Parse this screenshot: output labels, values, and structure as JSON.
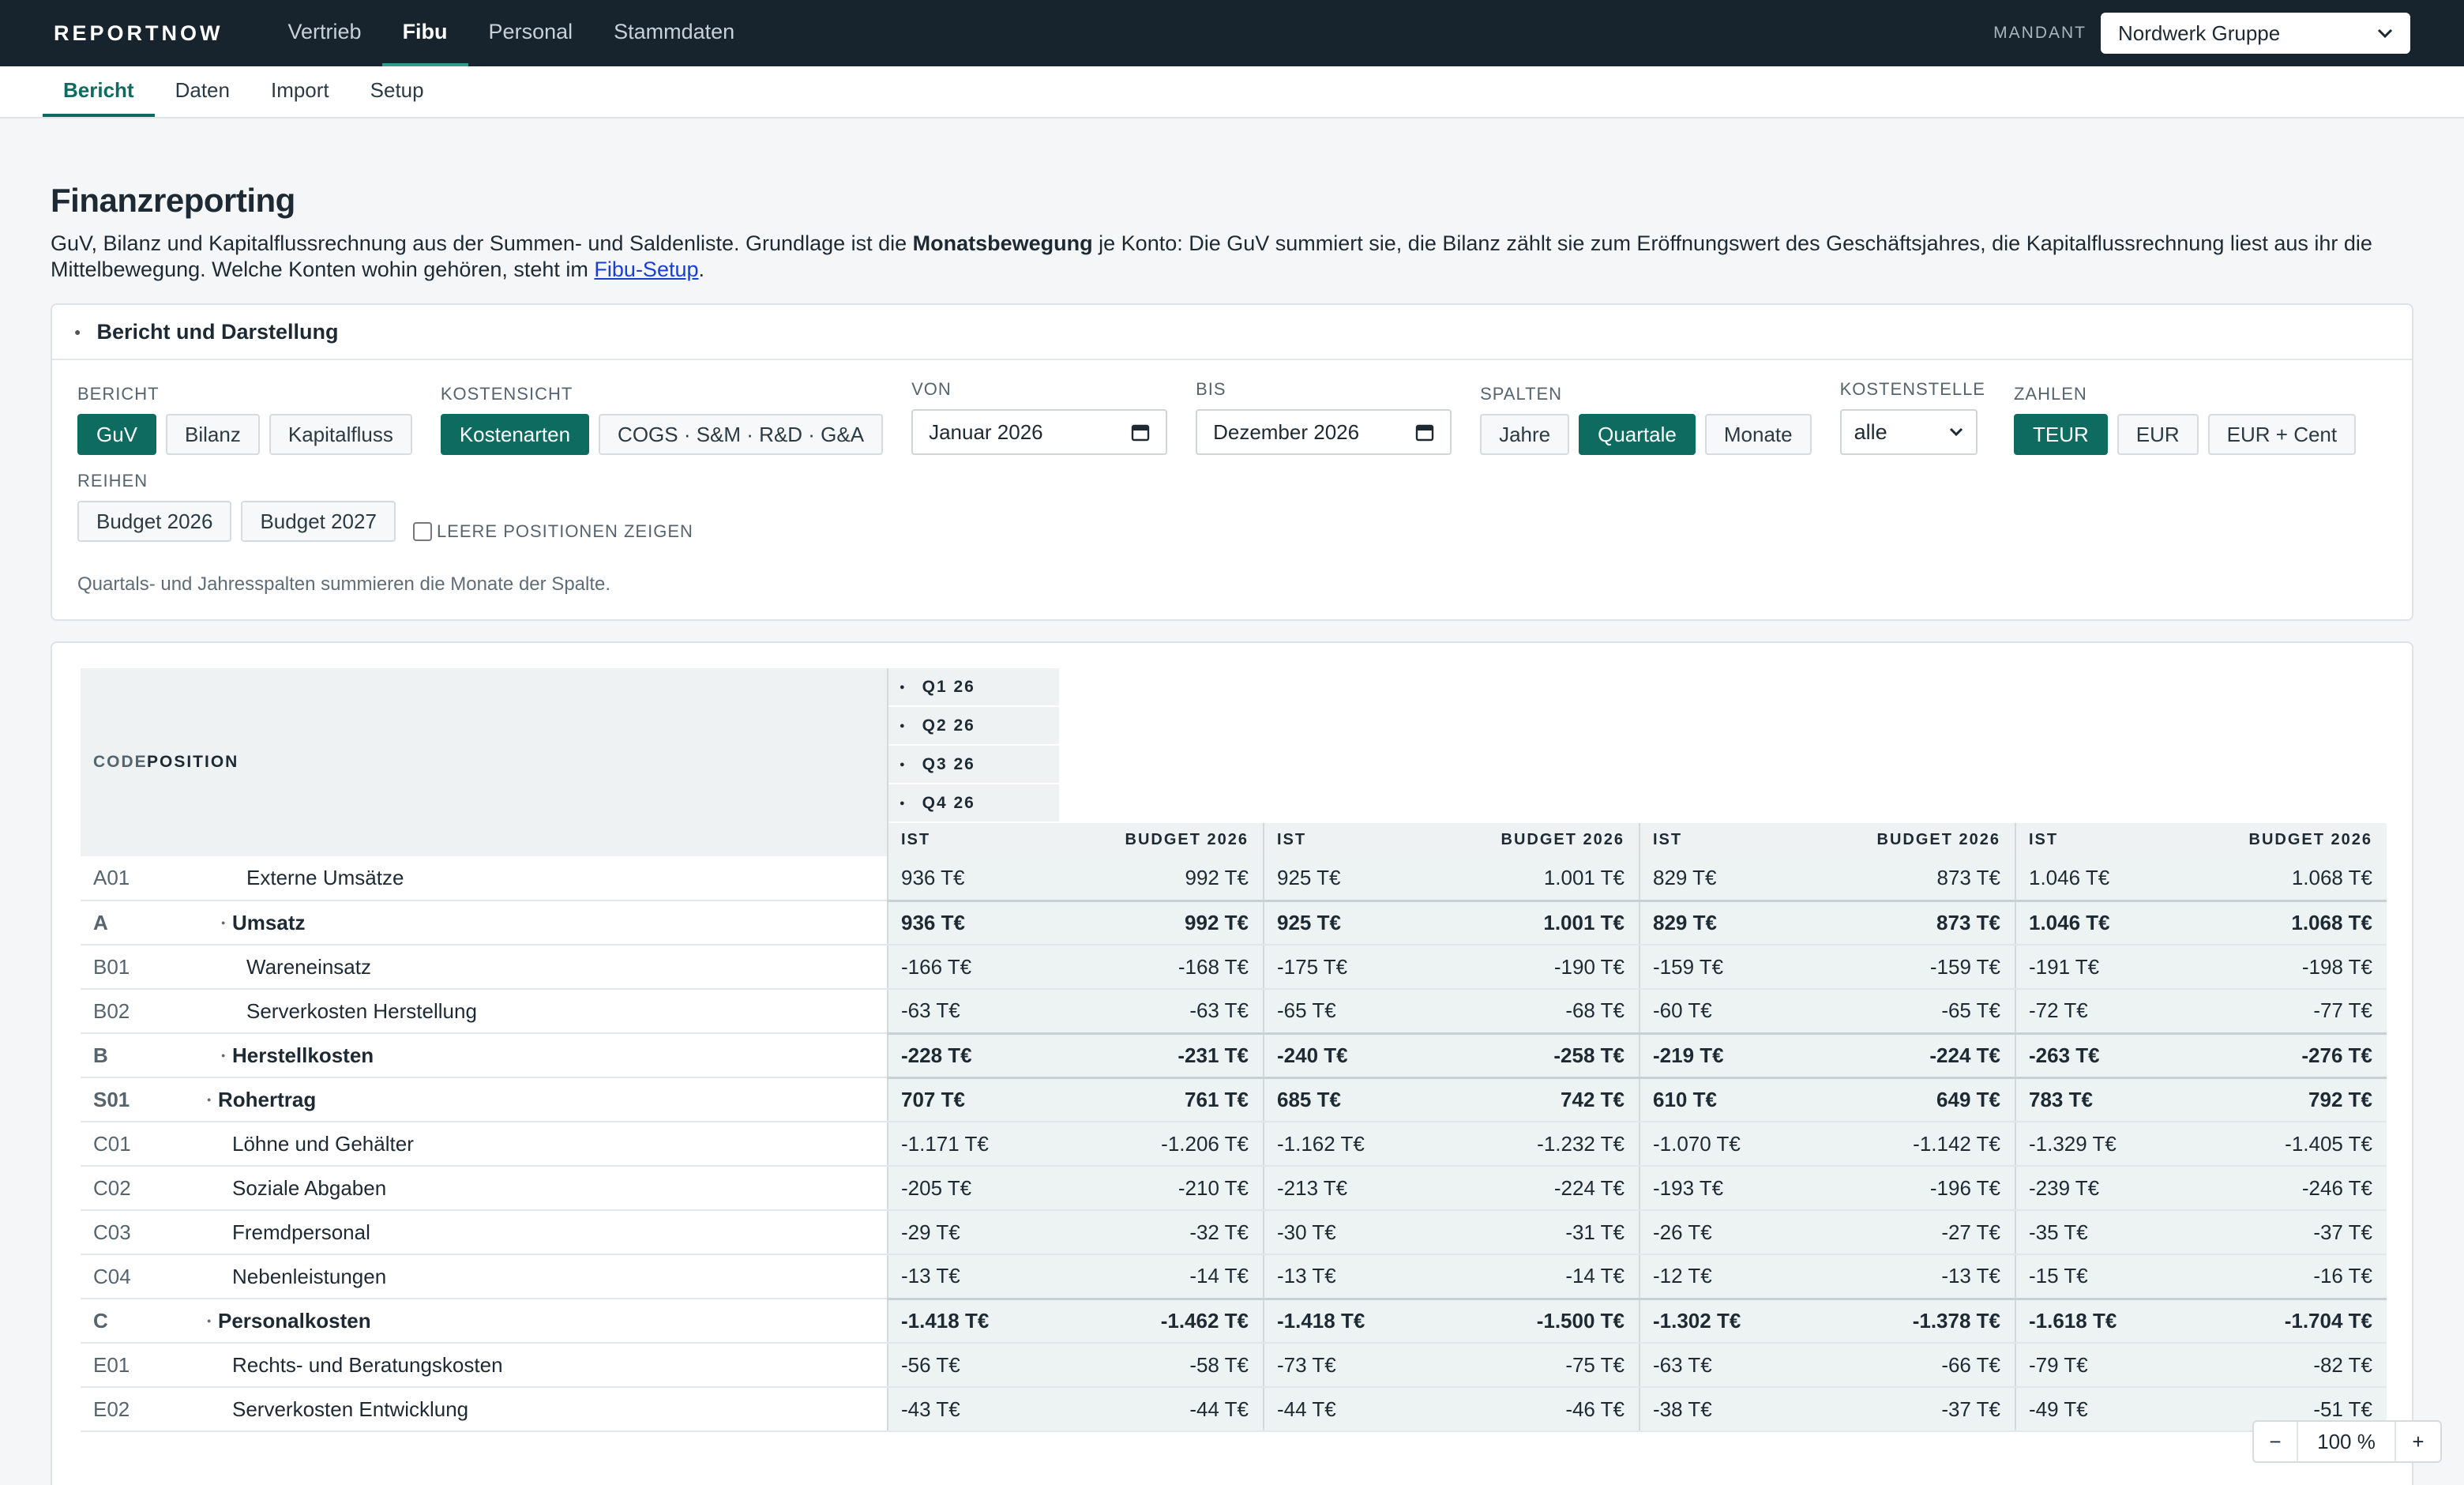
{
  "brand": "REPORTNOW",
  "topnav": [
    "Vertrieb",
    "Fibu",
    "Personal",
    "Stammdaten"
  ],
  "mandant": {
    "label": "MANDANT",
    "value": "Nordwerk Gruppe"
  },
  "subnav": [
    "Bericht",
    "Daten",
    "Import",
    "Setup"
  ],
  "page": {
    "title": "Finanzreporting",
    "desc_1": "GuV, Bilanz und Kapitalflussrechnung aus der Summen- und Saldenliste. Grundlage ist die ",
    "desc_bold": "Monatsbewegung",
    "desc_2": " je Konto: Die GuV summiert sie, die Bilanz zählt sie zum Eröffnungswert des Geschäftsjahres, die Kapitalflussrechnung liest aus ihr die Mittelbewegung. Welche Konten wohin gehören, steht im ",
    "desc_link": "Fibu-Setup",
    "desc_3": "."
  },
  "panel": {
    "title": "Bericht und Darstellung",
    "bericht": {
      "label": "BERICHT",
      "options": [
        "GuV",
        "Bilanz",
        "Kapitalfluss"
      ]
    },
    "kostensicht": {
      "label": "KOSTENSICHT",
      "options": [
        "Kostenarten",
        "COGS · S&M · R&D · G&A"
      ]
    },
    "von": {
      "label": "VON",
      "value": "Januar  2026"
    },
    "bis": {
      "label": "BIS",
      "value": "Dezember  2026"
    },
    "spalten": {
      "label": "SPALTEN",
      "options": [
        "Jahre",
        "Quartale",
        "Monate"
      ]
    },
    "kostenstelle": {
      "label": "KOSTENSTELLE",
      "value": "alle"
    },
    "zahlen": {
      "label": "ZAHLEN",
      "options": [
        "TEUR",
        "EUR",
        "EUR + Cent"
      ]
    },
    "reihen": {
      "label": "REIHEN",
      "options": [
        "Budget 2026",
        "Budget 2027"
      ]
    },
    "leere": "LEERE POSITIONEN ZEIGEN",
    "hint": "Quartals- und Jahresspalten summieren die Monate der Spalte."
  },
  "table": {
    "col_code": "CODE",
    "col_position": "POSITION",
    "quarters": [
      "Q1 26",
      "Q2 26",
      "Q3 26",
      "Q4 26"
    ],
    "sub_ist": "IST",
    "sub_budget": "BUDGET 2026",
    "rows": [
      {
        "code": "A01",
        "name": "Externe Umsätze",
        "v": [
          "936 T€",
          "992 T€",
          "925 T€",
          "1.001 T€",
          "829 T€",
          "873 T€",
          "1.046 T€",
          "1.068 T€"
        ]
      },
      {
        "code": "A",
        "name": "Umsatz",
        "v": [
          "936 T€",
          "992 T€",
          "925 T€",
          "1.001 T€",
          "829 T€",
          "873 T€",
          "1.046 T€",
          "1.068 T€"
        ]
      },
      {
        "code": "B01",
        "name": "Wareneinsatz",
        "v": [
          "-166 T€",
          "-168 T€",
          "-175 T€",
          "-190 T€",
          "-159 T€",
          "-159 T€",
          "-191 T€",
          "-198 T€"
        ]
      },
      {
        "code": "B02",
        "name": "Serverkosten Herstellung",
        "v": [
          "-63 T€",
          "-63 T€",
          "-65 T€",
          "-68 T€",
          "-60 T€",
          "-65 T€",
          "-72 T€",
          "-77 T€"
        ]
      },
      {
        "code": "B",
        "name": "Herstellkosten",
        "v": [
          "-228 T€",
          "-231 T€",
          "-240 T€",
          "-258 T€",
          "-219 T€",
          "-224 T€",
          "-263 T€",
          "-276 T€"
        ]
      },
      {
        "code": "S01",
        "name": "Rohertrag",
        "v": [
          "707 T€",
          "761 T€",
          "685 T€",
          "742 T€",
          "610 T€",
          "649 T€",
          "783 T€",
          "792 T€"
        ]
      },
      {
        "code": "C01",
        "name": "Löhne und Gehälter",
        "v": [
          "-1.171 T€",
          "-1.206 T€",
          "-1.162 T€",
          "-1.232 T€",
          "-1.070 T€",
          "-1.142 T€",
          "-1.329 T€",
          "-1.405 T€"
        ]
      },
      {
        "code": "C02",
        "name": "Soziale Abgaben",
        "v": [
          "-205 T€",
          "-210 T€",
          "-213 T€",
          "-224 T€",
          "-193 T€",
          "-196 T€",
          "-239 T€",
          "-246 T€"
        ]
      },
      {
        "code": "C03",
        "name": "Fremdpersonal",
        "v": [
          "-29 T€",
          "-32 T€",
          "-30 T€",
          "-31 T€",
          "-26 T€",
          "-27 T€",
          "-35 T€",
          "-37 T€"
        ]
      },
      {
        "code": "C04",
        "name": "Nebenleistungen",
        "v": [
          "-13 T€",
          "-14 T€",
          "-13 T€",
          "-14 T€",
          "-12 T€",
          "-13 T€",
          "-15 T€",
          "-16 T€"
        ]
      },
      {
        "code": "C",
        "name": "Personalkosten",
        "v": [
          "-1.418 T€",
          "-1.462 T€",
          "-1.418 T€",
          "-1.500 T€",
          "-1.302 T€",
          "-1.378 T€",
          "-1.618 T€",
          "-1.704 T€"
        ]
      },
      {
        "code": "E01",
        "name": "Rechts- und Beratungskosten",
        "v": [
          "-56 T€",
          "-58 T€",
          "-73 T€",
          "-75 T€",
          "-63 T€",
          "-66 T€",
          "-79 T€",
          "-82 T€"
        ]
      },
      {
        "code": "E02",
        "name": "Serverkosten Entwicklung",
        "v": [
          "-43 T€",
          "-44 T€",
          "-44 T€",
          "-46 T€",
          "-38 T€",
          "-37 T€",
          "-49 T€",
          "-51 T€"
        ]
      }
    ]
  },
  "zoom": {
    "minus": "−",
    "value": "100 %",
    "plus": "+"
  }
}
